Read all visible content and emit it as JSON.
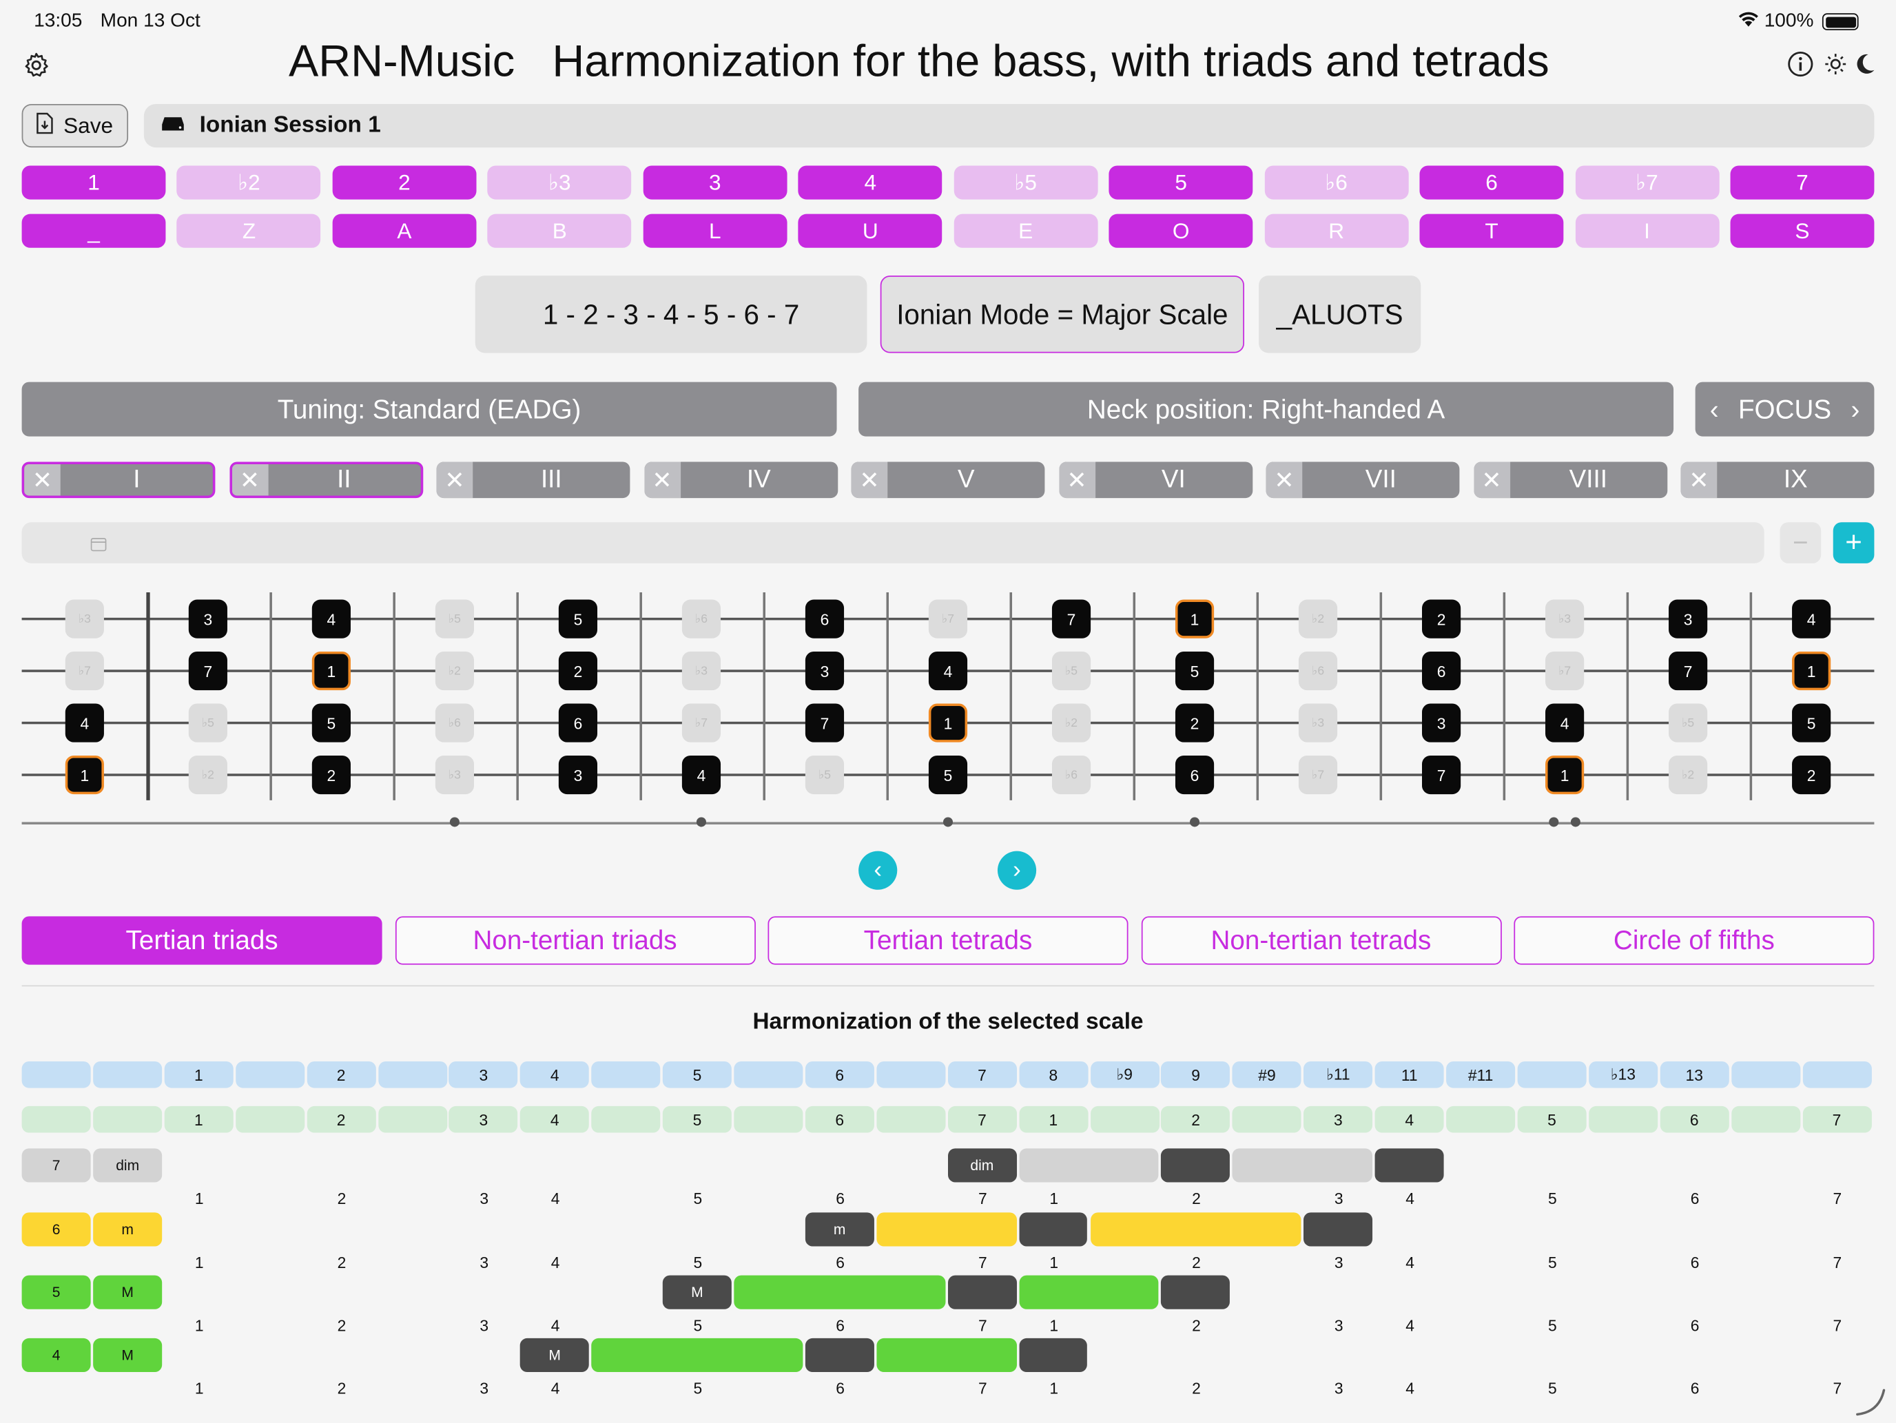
{
  "status": {
    "time": "13:05",
    "date": "Mon 13 Oct",
    "battery": "100%"
  },
  "header": {
    "title": "ARN-Music   Harmonization for the bass, with triads and tetrads"
  },
  "toolbar": {
    "save_label": "Save",
    "session": "Ionian Session 1"
  },
  "degrees": [
    {
      "label": "1",
      "letter": "_",
      "on": true
    },
    {
      "label": "♭2",
      "letter": "Z",
      "on": false
    },
    {
      "label": "2",
      "letter": "A",
      "on": true
    },
    {
      "label": "♭3",
      "letter": "B",
      "on": false
    },
    {
      "label": "3",
      "letter": "L",
      "on": true
    },
    {
      "label": "4",
      "letter": "U",
      "on": true
    },
    {
      "label": "♭5",
      "letter": "E",
      "on": false
    },
    {
      "label": "5",
      "letter": "O",
      "on": true
    },
    {
      "label": "♭6",
      "letter": "R",
      "on": false
    },
    {
      "label": "6",
      "letter": "T",
      "on": true
    },
    {
      "label": "♭7",
      "letter": "I",
      "on": false
    },
    {
      "label": "7",
      "letter": "S",
      "on": true
    }
  ],
  "scale_info": {
    "formula": "1 - 2 - 3 - 4 - 5 - 6 - 7",
    "mode": "Ionian Mode = Major Scale",
    "code": "_ALUOTS"
  },
  "settings": {
    "tuning": "Tuning: Standard (EADG)",
    "neck": "Neck position: Right-handed A",
    "focus": "FOCUS"
  },
  "positions": [
    {
      "label": "I",
      "selected": true
    },
    {
      "label": "II",
      "selected": true
    },
    {
      "label": "III",
      "selected": false
    },
    {
      "label": "IV",
      "selected": false
    },
    {
      "label": "V",
      "selected": false
    },
    {
      "label": "VI",
      "selected": false
    },
    {
      "label": "VII",
      "selected": false
    },
    {
      "label": "VIII",
      "selected": false
    },
    {
      "label": "IX",
      "selected": false
    }
  ],
  "fretboard": {
    "strings": [
      [
        "♭3",
        "3",
        "4",
        "♭5",
        "5",
        "♭6",
        "6",
        "♭7",
        "7",
        "1",
        "♭2",
        "2",
        "♭3",
        "3",
        "4"
      ],
      [
        "♭7",
        "7",
        "1",
        "♭2",
        "2",
        "♭3",
        "3",
        "4",
        "♭5",
        "5",
        "♭6",
        "6",
        "♭7",
        "7",
        "1"
      ],
      [
        "4",
        "♭5",
        "5",
        "♭6",
        "6",
        "♭7",
        "7",
        "1",
        "♭2",
        "2",
        "♭3",
        "3",
        "4",
        "♭5",
        "5"
      ],
      [
        "1",
        "♭2",
        "2",
        "♭3",
        "3",
        "4",
        "♭5",
        "5",
        "♭6",
        "6",
        "♭7",
        "7",
        "1",
        "♭2",
        "2"
      ]
    ]
  },
  "tabs": [
    {
      "label": "Tertian triads",
      "active": true
    },
    {
      "label": "Non-tertian triads",
      "active": false
    },
    {
      "label": "Tertian tetrads",
      "active": false
    },
    {
      "label": "Non-tertian tetrads",
      "active": false
    },
    {
      "label": "Circle of fifths",
      "active": false
    }
  ],
  "harmonization": {
    "title": "Harmonization of the selected scale",
    "intervals": [
      "",
      "",
      "1",
      "",
      "2",
      "",
      "3",
      "4",
      "",
      "5",
      "",
      "6",
      "",
      "7",
      "8",
      "♭9",
      "9",
      "#9",
      "♭11",
      "11",
      "#11",
      "",
      "♭13",
      "13",
      "",
      ""
    ],
    "degrees": [
      "",
      "",
      "1",
      "",
      "2",
      "",
      "3",
      "4",
      "",
      "5",
      "",
      "6",
      "",
      "7",
      "1",
      "",
      "2",
      "",
      "3",
      "4",
      "",
      "5",
      "",
      "6",
      "",
      "7"
    ],
    "rows": [
      {
        "degree": "7",
        "quality": "dim",
        "color": "#d3d3d3",
        "degree_nums": [
          "1",
          "2",
          "3",
          "4",
          "5",
          "6",
          "7",
          "1",
          "2",
          "3",
          "4",
          "5",
          "6",
          "7"
        ]
      },
      {
        "degree": "6",
        "quality": "m",
        "color": "#fcd632",
        "degree_nums": [
          "1",
          "2",
          "3",
          "4",
          "5",
          "6",
          "7",
          "1",
          "2",
          "3",
          "4",
          "5",
          "6",
          "7"
        ]
      },
      {
        "degree": "5",
        "quality": "M",
        "color": "#60d43c",
        "degree_nums": [
          "1",
          "2",
          "3",
          "4",
          "5",
          "6",
          "7",
          "1",
          "2",
          "3",
          "4",
          "5",
          "6",
          "7"
        ]
      },
      {
        "degree": "4",
        "quality": "M",
        "color": "#60d43c",
        "degree_nums": [
          "1",
          "2",
          "3",
          "4",
          "5",
          "6",
          "7",
          "1",
          "2",
          "3",
          "4",
          "5",
          "6",
          "7"
        ]
      }
    ]
  }
}
